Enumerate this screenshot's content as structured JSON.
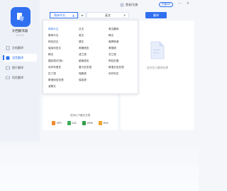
{
  "app": {
    "name": "文档翻译器",
    "version": "V1.0.0"
  },
  "sidebar": {
    "items": [
      {
        "label": "文档翻译",
        "icon": "document-icon"
      },
      {
        "label": "语音翻译",
        "icon": "audio-icon",
        "active": true
      },
      {
        "label": "图片翻译",
        "icon": "image-icon"
      },
      {
        "label": "短信翻译",
        "icon": "message-icon"
      }
    ]
  },
  "topbar": {
    "user": "登录/注册",
    "vip": "开通VIP",
    "minimize": "—",
    "close": "✕"
  },
  "lang": {
    "from": "简体中文",
    "swap": "⇄",
    "to": "英文",
    "translate": "翻译"
  },
  "dropdown": {
    "columns": [
      [
        "简体中文",
        "繁体中文",
        "阿拉伯文",
        "保加利亚文",
        "韩文",
        "捷克语(巴西)",
        "匈牙利语言",
        "拉丁语",
        "斯洛伐尼亚语",
        "波斯文"
      ],
      [
        "日文",
        "英文",
        "德文",
        "希腊语言",
        "波兰语",
        "越南语言",
        "爱沙尼亚语",
        "瑞典语",
        "保加语"
      ],
      [
        "粤文翻译",
        "韩文",
        "俄罗斯语",
        "泰国语",
        "芬兰语",
        "阿拉伯语",
        "斯洛文尼亚语",
        "匈牙利文"
      ]
    ]
  },
  "right_panel": {
    "empty_text": "此处显示翻译结果"
  },
  "left_panel": {
    "formats_title": "支持以下格式文档",
    "formats": [
      {
        "label": "MP3",
        "color": "#f08a2c"
      },
      {
        "label": "AAC",
        "color": "#3fae5a"
      },
      {
        "label": "WMA",
        "color": "#2f9d4a"
      },
      {
        "label": "M4A",
        "color": "#f0a22c"
      }
    ]
  },
  "colors": {
    "accent": "#2f6ff0"
  }
}
